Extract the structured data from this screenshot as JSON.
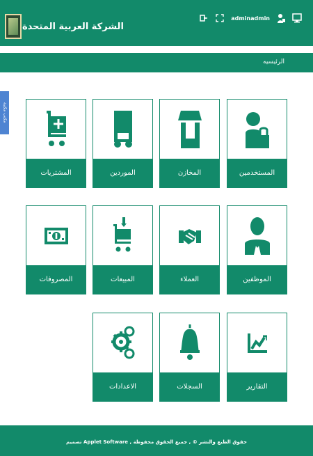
{
  "header": {
    "brand": "الشركة العربية المتحدة",
    "user": "adminadmin"
  },
  "breadcrumb": "الرئيسيه",
  "side_tab": "مكتب مكتبة",
  "cards": [
    {
      "label": "المستخدمين"
    },
    {
      "label": "المخازن"
    },
    {
      "label": "الموردين"
    },
    {
      "label": "المشتريات"
    },
    {
      "label": "الموظفين"
    },
    {
      "label": "العملاء"
    },
    {
      "label": "المبيعات"
    },
    {
      "label": "المصروفات"
    },
    {
      "label": "التقارير"
    },
    {
      "label": "السجلات"
    },
    {
      "label": "الاعدادات"
    }
  ],
  "footer": "تصميم Applet Software , حقوق الطبع والنشر © , جميع الحقوق محفوظة",
  "colors": {
    "primary": "#128a6a",
    "side_tab": "#4e84d2",
    "white": "#ffffff"
  },
  "icons": [
    "logout-icon",
    "fullscreen-icon",
    "user-lock-icon",
    "desktop-icon",
    "users-lock-icon",
    "store-icon",
    "truck-icon",
    "cart-plus-icon",
    "employee-icon",
    "handshake-icon",
    "cart-down-icon",
    "money-icon",
    "chart-icon",
    "bell-icon",
    "gears-icon"
  ]
}
